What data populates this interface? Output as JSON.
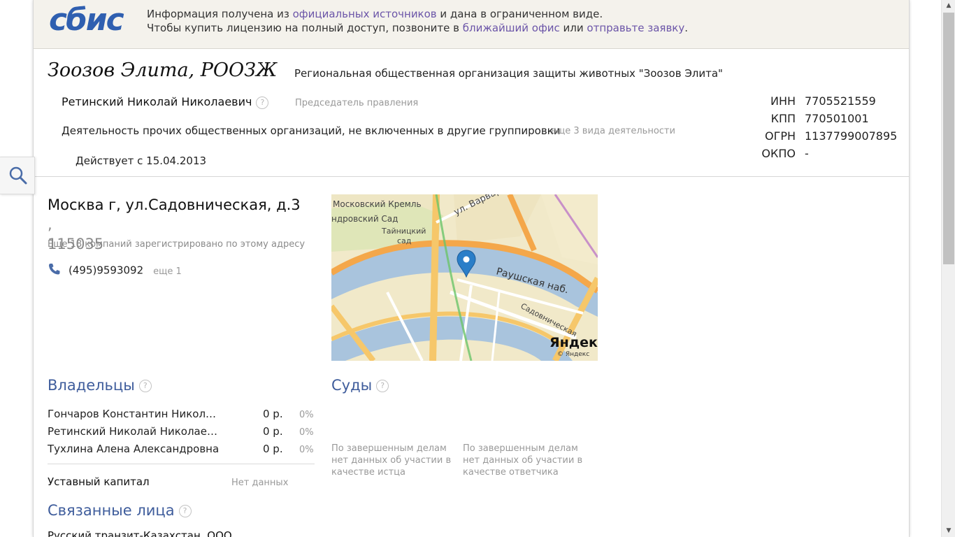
{
  "banner": {
    "logo_text": "сбис",
    "line1_prefix": "Информация получена из ",
    "line1_link": "официальных источников",
    "line1_suffix": " и дана в ограниченном виде.",
    "line2_prefix": "Чтобы купить лицензию на полный доступ, позвоните в ",
    "line2_link1": "ближайший офис",
    "line2_middle": " или ",
    "line2_link2": "отправьте заявку",
    "line2_suffix": "."
  },
  "company": {
    "short_name": "Зоозов Элита, РООЗЖ",
    "full_name": "Региональная общественная организация защиты животных \"Зоозов Элита\"",
    "director_name": "Ретинский Николай Николаевич",
    "director_role": "Председатель правления",
    "activity": "Деятельность прочих общественных организаций, не включенных в другие группировки",
    "activity_more": "еще 3 вида деятельности",
    "status": "Действует с 15.04.2013"
  },
  "requisites": [
    {
      "label": "ИНН",
      "value": "7705521559"
    },
    {
      "label": "КПП",
      "value": "770501001"
    },
    {
      "label": "ОГРН",
      "value": "1137799007895"
    },
    {
      "label": "ОКПО",
      "value": "-"
    }
  ],
  "address": {
    "street": "Москва г, ул.Садовническая, д.3",
    "postal": "115035",
    "note": "Еще 18 компаний зарегистрировано по этому адресу",
    "phone": "(495)9593092",
    "phone_more": "еще 1"
  },
  "map": {
    "labels": {
      "kremlin": "Московский Кремль",
      "varvarka": "ул. Варварка",
      "garden": "ндровский Сад",
      "taynitsky1": "Тайницкий",
      "taynitsky2": "сад",
      "raushskaya": "Раушская наб.",
      "sadovnicheskaya": "Садовническая",
      "yandex_logo": "Яндекс",
      "copyright": "© Яндекс"
    }
  },
  "owners": {
    "title": "Владельцы",
    "rows": [
      {
        "name": "Гончаров Константин Николае...",
        "amount": "0 р.",
        "share": "0%"
      },
      {
        "name": "Ретинский Николай Николаевич",
        "amount": "0 р.",
        "share": "0%"
      },
      {
        "name": "Тухлина Алена Александровна",
        "amount": "0 р.",
        "share": "0%"
      }
    ],
    "capital_label": "Уставный капитал",
    "capital_value": "Нет данных"
  },
  "courts": {
    "title": "Суды",
    "plaintiff_note": "По завершенным делам нет данных об участии в качестве истца",
    "defendant_note": "По завершенным делам нет данных об участии в качестве ответчика"
  },
  "related": {
    "title": "Связанные лица",
    "first_item": "Русский транзит-Казахстан, ООО"
  },
  "icons": {
    "help": "?",
    "search": "search-icon",
    "phone": "phone-icon",
    "map_pin": "map-pin-icon"
  },
  "colors": {
    "accent": "#6b55a8",
    "section_title": "#3f5d9c",
    "logo": "#2f5fb0",
    "banner_bg": "#f4f2ec"
  }
}
